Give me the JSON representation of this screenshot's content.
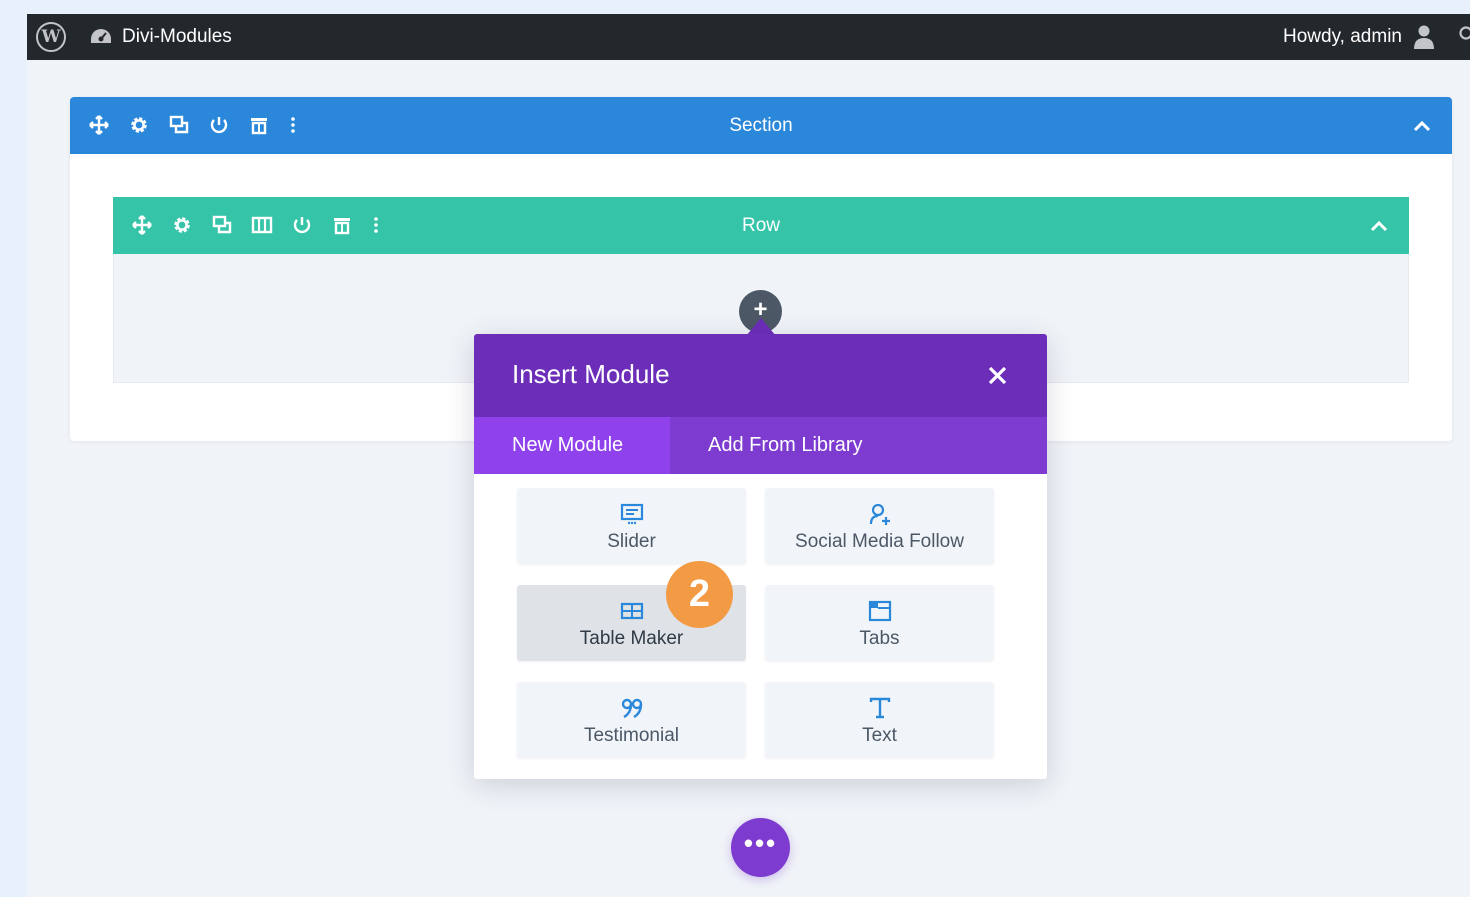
{
  "adminbar": {
    "site_name": "Divi-Modules",
    "greeting": "Howdy, admin"
  },
  "section": {
    "title": "Section"
  },
  "row": {
    "title": "Row"
  },
  "add_button": {
    "label": "+"
  },
  "modal": {
    "title": "Insert Module",
    "tabs": [
      {
        "label": "New Module",
        "active": true
      },
      {
        "label": "Add From Library",
        "active": false
      }
    ],
    "modules": [
      {
        "label": "Slider",
        "icon": "slider-icon"
      },
      {
        "label": "Social Media Follow",
        "icon": "social-follow-icon"
      },
      {
        "label": "Table Maker",
        "icon": "table-icon",
        "selected": true
      },
      {
        "label": "Tabs",
        "icon": "tabs-icon"
      },
      {
        "label": "Testimonial",
        "icon": "quote-icon"
      },
      {
        "label": "Text",
        "icon": "text-icon"
      }
    ]
  },
  "step_badge": {
    "number": "2"
  },
  "more_button": {
    "label": "•••"
  },
  "colors": {
    "section_bar": "#2b87da",
    "row_bar": "#35c4a8",
    "modal_header": "#6c2eb9",
    "modal_tabs": "#7e3bd0",
    "active_tab": "#8f42ec",
    "badge": "#f39a45",
    "module_icon": "#2b87da"
  }
}
